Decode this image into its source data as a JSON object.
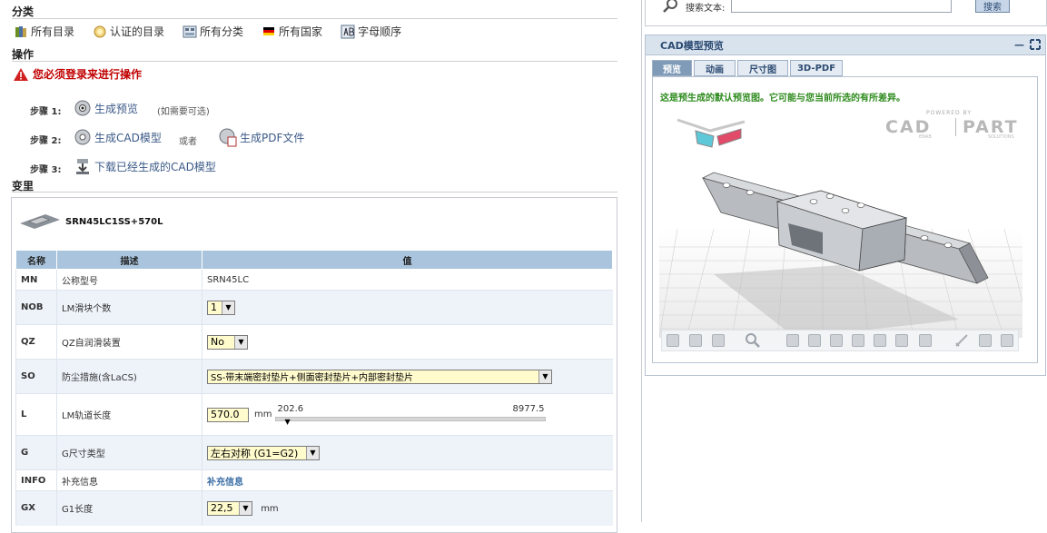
{
  "sections": {
    "category": "分类",
    "actions": "操作",
    "variants": "变里"
  },
  "nav": {
    "all_catalogs": "所有目录",
    "certified_catalogs": "认证的目录",
    "all_categories": "所有分类",
    "all_countries": "所有国家",
    "alphabetical": "字母顺序"
  },
  "actions": {
    "login_warning": "您必须登录来进行操作",
    "step1_label": "步骤 1:",
    "step1_link": "生成预览",
    "step1_note": "(如需要可选)",
    "step2_label": "步骤 2:",
    "step2_link": "生成CAD模型",
    "step2_or": "或者",
    "step2_link2": "生成PDF文件",
    "step3_label": "步骤 3:",
    "step3_link": "下载已经生成的CAD模型"
  },
  "product": {
    "name": "SRN45LC1SS+570L"
  },
  "table": {
    "headers": [
      "名称",
      "描述",
      "值"
    ],
    "rows": [
      {
        "key": "MN",
        "desc": "公称型号",
        "value": "SRN45LC"
      },
      {
        "key": "NOB",
        "desc": "LM滑块个数",
        "value": "1"
      },
      {
        "key": "QZ",
        "desc": "QZ自润滑装置",
        "value": "No"
      },
      {
        "key": "SO",
        "desc": "防尘措施(含LaCS)",
        "value": "SS-带末端密封垫片+侧面密封垫片+内部密封垫片"
      },
      {
        "key": "L",
        "desc": "LM轨道长度",
        "value": "570.0",
        "unit": "mm",
        "min": "202.6",
        "max": "8977.5",
        "slider_fraction": 0.0
      },
      {
        "key": "G",
        "desc": "G尺寸类型",
        "value": "左右对称 (G1=G2)"
      },
      {
        "key": "INFO",
        "desc": "补充信息",
        "value": "补充信息"
      },
      {
        "key": "GX",
        "desc": "G1长度",
        "value": "22,5",
        "unit": "mm"
      }
    ]
  },
  "search": {
    "label": "搜索文本:",
    "button": "搜索"
  },
  "cad": {
    "title": "CAD模型预览",
    "tabs": [
      "预览",
      "动画",
      "尺寸图",
      "3D-PDF"
    ],
    "active_tab": "预览",
    "notice": "这是预生成的默认预览图。它可能与您当前所选的有所差异。",
    "logo_top": "POWERED BY",
    "logo_left": "CAD",
    "logo_right": "PART",
    "logo_sub_left": "ENAB",
    "logo_sub_right": "SOLUTIONS",
    "colors": {
      "notice": "#2e8b1e",
      "header_text": "#2c4b72"
    }
  }
}
